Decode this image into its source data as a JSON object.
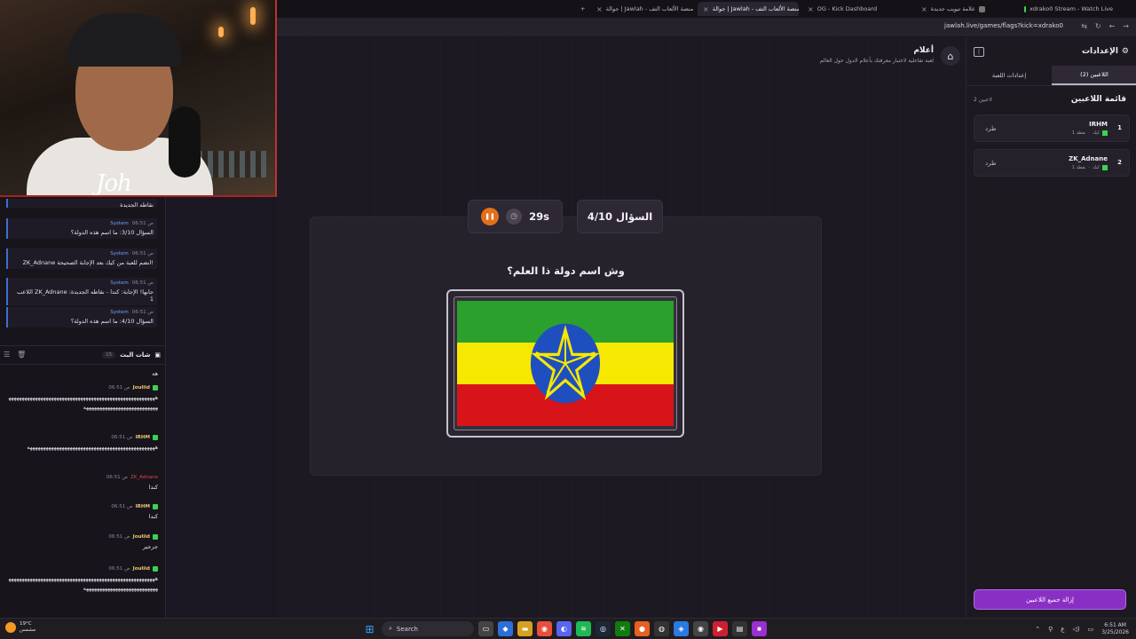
{
  "browser": {
    "tabs": [
      {
        "label": "علامة تبويب جديدة"
      },
      {
        "label": "xdrako0 Stream - Watch Live"
      },
      {
        "label": "OG - Kick Dashboard"
      },
      {
        "label": "جوالة | Jawlah - منصة الألعاب التف"
      },
      {
        "label": "جوالة | Jawlah - منصة الألعاب التف"
      }
    ],
    "url": "jawlah.live/games/flags?kick=xdrako0"
  },
  "chat": {
    "system_messages": [
      {
        "author": "System",
        "time": "06:51 ص",
        "text": "نقاطه الجديدة"
      },
      {
        "author": "System",
        "time": "06:51 ص",
        "text": "السؤال 3/10: ما اسم هذه الدولة؟"
      },
      {
        "author": "System",
        "time": "06:51 ص",
        "text": "ZK_Adnane انضم للعبة من كيك بعد الإجابة الصحيحة!"
      },
      {
        "author": "System",
        "time": "06:51 ص",
        "text": "اللاعب ZK_Adnane جابها! الإجابة: كندا - نقاطه الجديدة: 1"
      },
      {
        "author": "System",
        "time": "06:51 ص",
        "text": "السؤال 4/10: ما اسم هذه الدولة؟"
      }
    ],
    "header_title": "شات البث",
    "header_count": "15",
    "messages": [
      {
        "user": "",
        "time": "",
        "text": "هه"
      },
      {
        "user": "Jouliid",
        "time": "06:51 ص",
        "text": "هههههههههههههههههههههههههههههههههههههههههههههههههههههههههههههههههههههههههههههههههههه"
      },
      {
        "user": "IRHM",
        "time": "06:51 ص",
        "text": "ههههههههههههههههههههههههههههههههههههههههههههههههه"
      },
      {
        "user": "ZK_Adnane",
        "time": "06:51 ص",
        "text": "كندا"
      },
      {
        "user": "IRHM",
        "time": "06:51 ص",
        "text": "كندا"
      },
      {
        "user": "Jouliid",
        "time": "06:51 ص",
        "text": "جرجير"
      },
      {
        "user": "Jouliid",
        "time": "06:51 ص",
        "text": "هههههههههههههههههههههههههههههههههههههههههههههههههههههههههههههههههههههههههههههههههههه"
      }
    ]
  },
  "webcam": {
    "overlay_text": "Joh"
  },
  "game": {
    "title": "أعلام",
    "subtitle": "لعبة تفاعلية لاختبار معرفتك بأعلام الدول حول العالم",
    "question_counter": "السؤال 4/10",
    "timer": "29s",
    "question": "وش اسم دولة ذا العلم؟"
  },
  "sidebar": {
    "title": "الإعدادات",
    "tabs": [
      {
        "label": "اللاعبين (2)"
      },
      {
        "label": "إعدادات اللعبة"
      }
    ],
    "players_heading": "قائمة اللاعبين",
    "players_count": "2 لاعبين",
    "players": [
      {
        "rank": "1",
        "name": "IRHM",
        "platform": "كيك",
        "points": "1 نقطة",
        "kick_label": "طرد"
      },
      {
        "rank": "2",
        "name": "ZK_Adnane",
        "platform": "كيك",
        "points": "1 نقطة",
        "kick_label": "طرد"
      }
    ],
    "clear_button": "إزالة جميع اللاعبين"
  },
  "taskbar": {
    "weather_temp": "19°C",
    "weather_desc": "مشمس",
    "search_label": "Search",
    "time": "6:51 AM",
    "date": "3/25/2026",
    "lang": "ع"
  },
  "colors": {
    "accent_purple": "#8a2fc4",
    "pause_orange": "#e2701b",
    "kick_green": "#39d353",
    "system_blue": "#3b6fd6"
  }
}
